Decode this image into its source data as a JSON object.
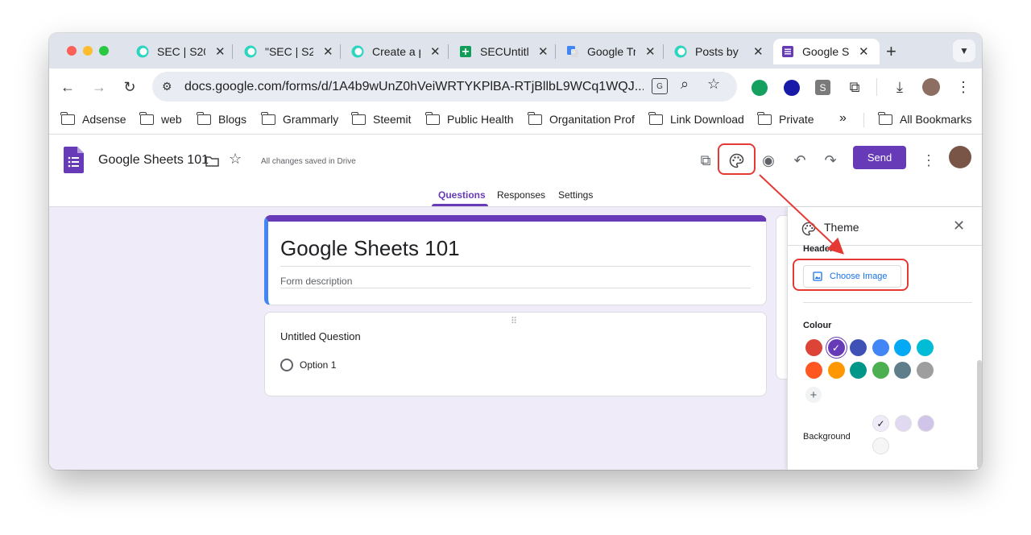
{
  "browser": {
    "tabs": [
      {
        "title": "SEC | S20",
        "favicon": "steemit-icon",
        "color": "#2dd4bf"
      },
      {
        "title": "\"SEC | S2",
        "favicon": "steemit-icon",
        "color": "#2dd4bf"
      },
      {
        "title": "Create a p",
        "favicon": "steemit-icon",
        "color": "#2dd4bf"
      },
      {
        "title": "SECUntitl",
        "favicon": "sheets-icon",
        "color": "#0f9d58"
      },
      {
        "title": "Google Tr",
        "favicon": "translate-icon",
        "color": "#4285f4"
      },
      {
        "title": "Posts by",
        "favicon": "steemit-icon",
        "color": "#2dd4bf"
      },
      {
        "title": "Google S",
        "favicon": "forms-icon",
        "color": "#673ab7"
      }
    ],
    "url": "docs.google.com/forms/d/1A4b9wUnZ0hVeiWRTYKPlBA-RTjBllbL9WCq1WQJ...",
    "bookmarks": [
      "Adsense",
      "web",
      "Blogs",
      "Grammarly",
      "Steemit",
      "Public Health",
      "Organitation Prof",
      "Link Download",
      "Private"
    ],
    "overflow": "»",
    "all_bookmarks": "All Bookmarks"
  },
  "forms": {
    "doc_title": "Google Sheets 101",
    "saved_status": "All changes saved in Drive",
    "send_label": "Send",
    "tabs": [
      "Questions",
      "Responses",
      "Settings"
    ],
    "form_title": "Google Sheets 101",
    "form_description": "Form description",
    "question_title": "Untitled Question",
    "option_1": "Option 1"
  },
  "theme_panel": {
    "title": "Theme",
    "header_label": "Header",
    "choose_image_label": "Choose Image",
    "colour_label": "Colour",
    "background_label": "Background",
    "colours": [
      "#db4437",
      "#673ab7",
      "#3f51b5",
      "#4285f4",
      "#03a9f4",
      "#00bcd4",
      "#ff5722",
      "#ff9800",
      "#009688",
      "#4caf50",
      "#607d8b",
      "#9e9e9e"
    ],
    "selected_colour": "#673ab7",
    "backgrounds": [
      "#f0ebf8",
      "#e1d8f1",
      "#d1c4e9",
      "#f6f6f6"
    ]
  },
  "accent": "#673ab7",
  "annotation_color": "#e53935"
}
